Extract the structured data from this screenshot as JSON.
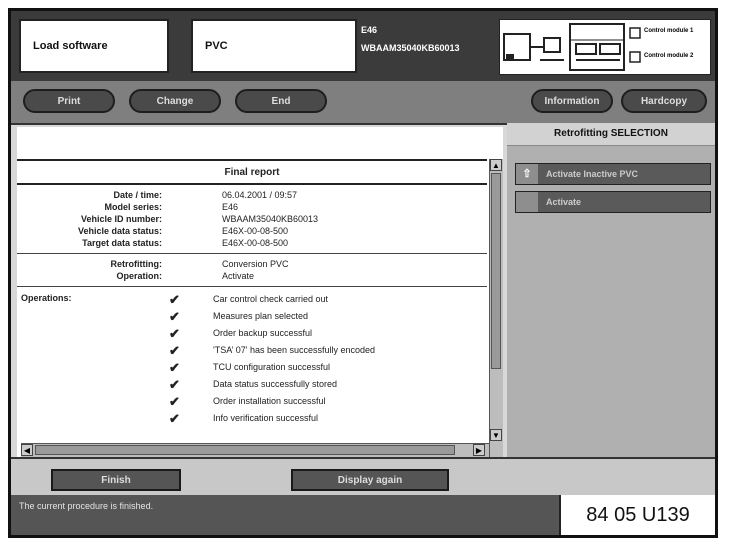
{
  "header": {
    "task_label": "Load software",
    "vehicle_label": "PVC",
    "info_line1": "E46",
    "info_line2": "WBAAM35040KB60013",
    "diagram_label_1": "Control module 1",
    "diagram_label_2": "Control module 2"
  },
  "toolbar": {
    "print_label": "Print",
    "change_label": "Change",
    "end_label": "End",
    "information_label": "Information",
    "hardcopy_label": "Hardcopy"
  },
  "report": {
    "title": "Final report",
    "details": [
      {
        "key": "Date / time:",
        "value": "06.04.2001 / 09:57"
      },
      {
        "key": "Model series:",
        "value": "E46"
      },
      {
        "key": "Vehicle ID number:",
        "value": "WBAAM35040KB60013"
      },
      {
        "key": "Vehicle data status:",
        "value": "E46X-00-08-500"
      },
      {
        "key": "Target data status:",
        "value": "E46X-00-08-500"
      }
    ],
    "retrofit": [
      {
        "key": "Retrofitting:",
        "value": "Conversion PVC"
      },
      {
        "key": "Operation:",
        "value": "Activate"
      }
    ],
    "operations_label": "Operations:",
    "operations": [
      {
        "text": "Car control check carried out"
      },
      {
        "text": "Measures plan selected"
      },
      {
        "text": "Order backup successful"
      },
      {
        "text": "'TSA’ 07' has been successfully encoded"
      },
      {
        "text": "TCU configuration successful"
      },
      {
        "text": "Data status successfully stored"
      },
      {
        "text": "Order installation successful"
      },
      {
        "text": "Info verification successful"
      }
    ]
  },
  "right_panel": {
    "title": "Retrofitting SELECTION",
    "items": [
      {
        "label": "Activate Inactive PVC"
      },
      {
        "label": "Activate"
      }
    ]
  },
  "footer": {
    "finish_label": "Finish",
    "display_again_label": "Display again",
    "status_text": "The current procedure is finished.",
    "image_code": "84 05 U139"
  }
}
